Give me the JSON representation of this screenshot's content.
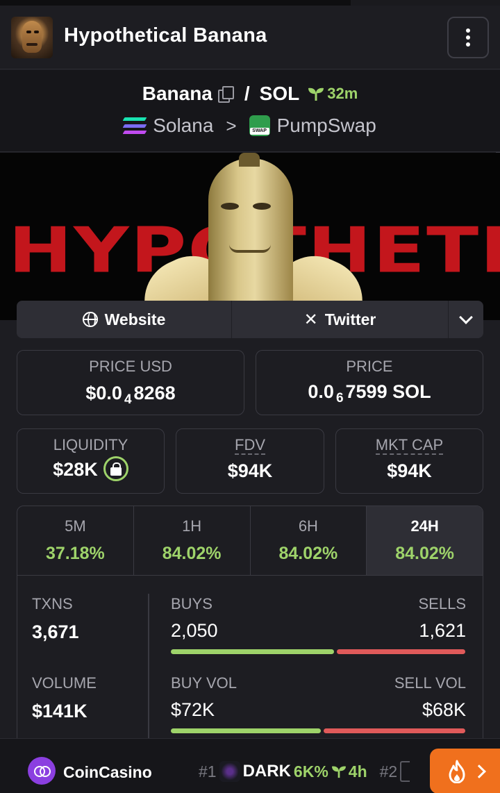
{
  "header": {
    "title": "Hypothetical Banana",
    "avatar_icon": "banana-character-avatar",
    "menu_icon": "kebab-menu-icon"
  },
  "pair": {
    "base": "Banana",
    "slash": "/",
    "quote": "SOL",
    "age": "32m",
    "chain": "Solana",
    "separator": ">",
    "dex": "PumpSwap",
    "dex_badge": "SWAP"
  },
  "banner": {
    "text": "HYPOTHETICAL"
  },
  "links": {
    "website": "Website",
    "twitter": "Twitter"
  },
  "price": {
    "usd_label": "PRICE USD",
    "usd_prefix": "$0.0",
    "usd_zeros": "4",
    "usd_digits": "8268",
    "native_label": "PRICE",
    "native_prefix": "0.0",
    "native_zeros": "6",
    "native_digits": "7599 SOL"
  },
  "metrics": {
    "liquidity_label": "LIQUIDITY",
    "liquidity": "$28K",
    "fdv_label": "FDV",
    "fdv": "$94K",
    "mcap_label": "MKT CAP",
    "mcap": "$94K"
  },
  "timeframes": [
    {
      "label": "5M",
      "change": "37.18%"
    },
    {
      "label": "1H",
      "change": "84.02%"
    },
    {
      "label": "6H",
      "change": "84.02%"
    },
    {
      "label": "24H",
      "change": "84.02%"
    }
  ],
  "stats": {
    "txns_label": "TXNS",
    "txns": "3,671",
    "buys_label": "BUYS",
    "buys": "2,050",
    "sells_label": "SELLS",
    "sells": "1,621",
    "volume_label": "VOLUME",
    "volume": "$141K",
    "buy_vol_label": "BUY VOL",
    "buy_vol": "$72K",
    "sell_vol_label": "SELL VOL",
    "sell_vol": "$68K",
    "buys_fraction": 0.558,
    "buy_vol_fraction": 0.514
  },
  "footer": {
    "sponsor": "CoinCasino",
    "rank1": "#1",
    "ticker1": "DARK",
    "ticker1_pct": "6K%",
    "ticker1_age": "4h",
    "rank2": "#2"
  },
  "colors": {
    "positive": "#9ed36a",
    "negative": "#e05a5a",
    "accent": "#f0701d",
    "background": "#1d1d22"
  }
}
